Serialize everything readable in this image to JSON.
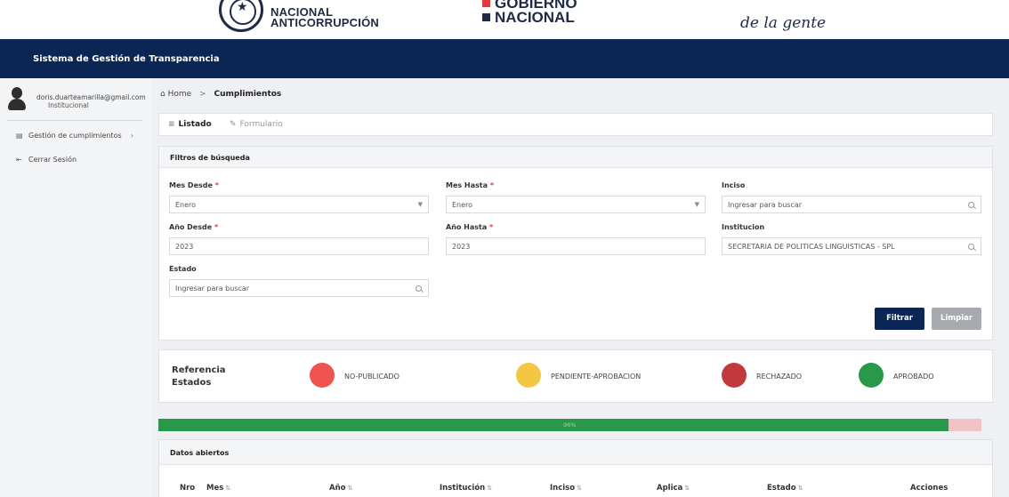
{
  "banner": {
    "logo1_line1": "NACIONAL",
    "logo1_line2": "ANTICORRUPCIÓN",
    "logo2_line1": "GOBIERNO",
    "logo2_line2": "NACIONAL",
    "logo3_text": "de la gente",
    "logo2_square_colors": [
      "#e0393e",
      "#1f2a44"
    ]
  },
  "app": {
    "title": "Sistema de Gestión de Transparencia",
    "header_color": "#0b2554"
  },
  "user": {
    "email": "doris.duarteamarilla@gmail.com",
    "role": "Institucional",
    "avatar_icon": "user-avatar-icon"
  },
  "sidebar": {
    "items": [
      {
        "label": "Gestión de cumplimientos",
        "icon": "list-icon",
        "chevron": "›"
      },
      {
        "label": "Cerrar Sesión",
        "icon": "logout-icon"
      }
    ]
  },
  "breadcrumb": {
    "home": "Home",
    "separator": ">",
    "current": "Cumplimientos"
  },
  "tabs": [
    {
      "label": "Listado",
      "icon": "list-icon",
      "active": true
    },
    {
      "label": "Formulario",
      "icon": "edit-icon",
      "active": false
    }
  ],
  "filters": {
    "title": "Filtros de búsqueda",
    "required_mark": "*",
    "mes_desde": {
      "label": "Mes Desde",
      "value": "Enero"
    },
    "mes_hasta": {
      "label": "Mes Hasta",
      "value": "Enero"
    },
    "inciso": {
      "label": "Inciso",
      "placeholder": "Ingresar para buscar"
    },
    "anio_desde": {
      "label": "Año Desde",
      "value": "2023"
    },
    "anio_hasta": {
      "label": "Año Hasta",
      "value": "2023"
    },
    "institucion": {
      "label": "Institucion",
      "value": "SECRETARIA DE POLITICAS LINGUISTICAS - SPL"
    },
    "estado": {
      "label": "Estado",
      "placeholder": "Ingresar para buscar"
    },
    "filter_button": "Filtrar",
    "clear_button": "Limpiar"
  },
  "legend": {
    "title_line1": "Referencia",
    "title_line2": "Estados",
    "items": [
      {
        "label": "NO-PUBLICADO",
        "color": "#ef5350"
      },
      {
        "label": "PENDIENTE-APROBACION",
        "color": "#f2c744"
      },
      {
        "label": "RECHAZADO",
        "color": "#c0393d"
      },
      {
        "label": "APROBADO",
        "color": "#28994a"
      }
    ]
  },
  "progress": {
    "percent": 96,
    "label": "96%",
    "fill_color": "#28994a",
    "track_color": "#f0c4c6"
  },
  "datos": {
    "title": "Datos abiertos",
    "sort_icon": "⇅",
    "columns": [
      "Nro",
      "Mes",
      "Año",
      "Institución",
      "Inciso",
      "Aplica",
      "Estado",
      "Acciones"
    ]
  }
}
